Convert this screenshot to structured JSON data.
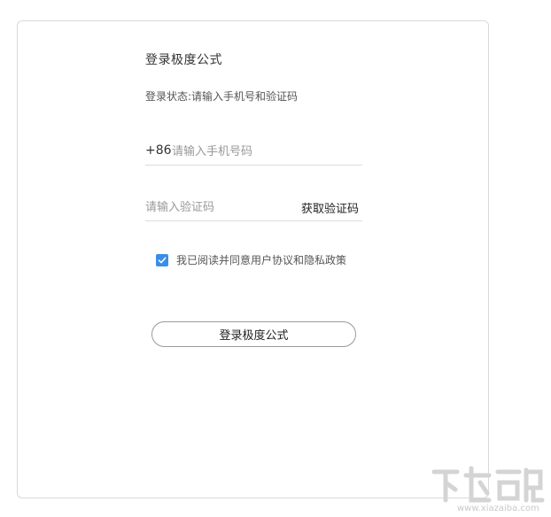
{
  "login": {
    "title": "登录极度公式",
    "status": "登录状态:请输入手机号和验证码",
    "phone_prefix": "+86",
    "phone_placeholder": "请输入手机号码",
    "phone_value": "",
    "code_placeholder": "请输入验证码",
    "code_value": "",
    "get_code_label": "获取验证码",
    "agreement_text": "我已阅读并同意用户协议和隐私政策",
    "agreement_checked": true,
    "submit_label": "登录极度公式"
  },
  "colors": {
    "checkbox": "#3a8ee6",
    "card_border": "#d9d9d9"
  },
  "watermark": {
    "text": "www.xiazaiba.com",
    "logo": "下载吧"
  }
}
